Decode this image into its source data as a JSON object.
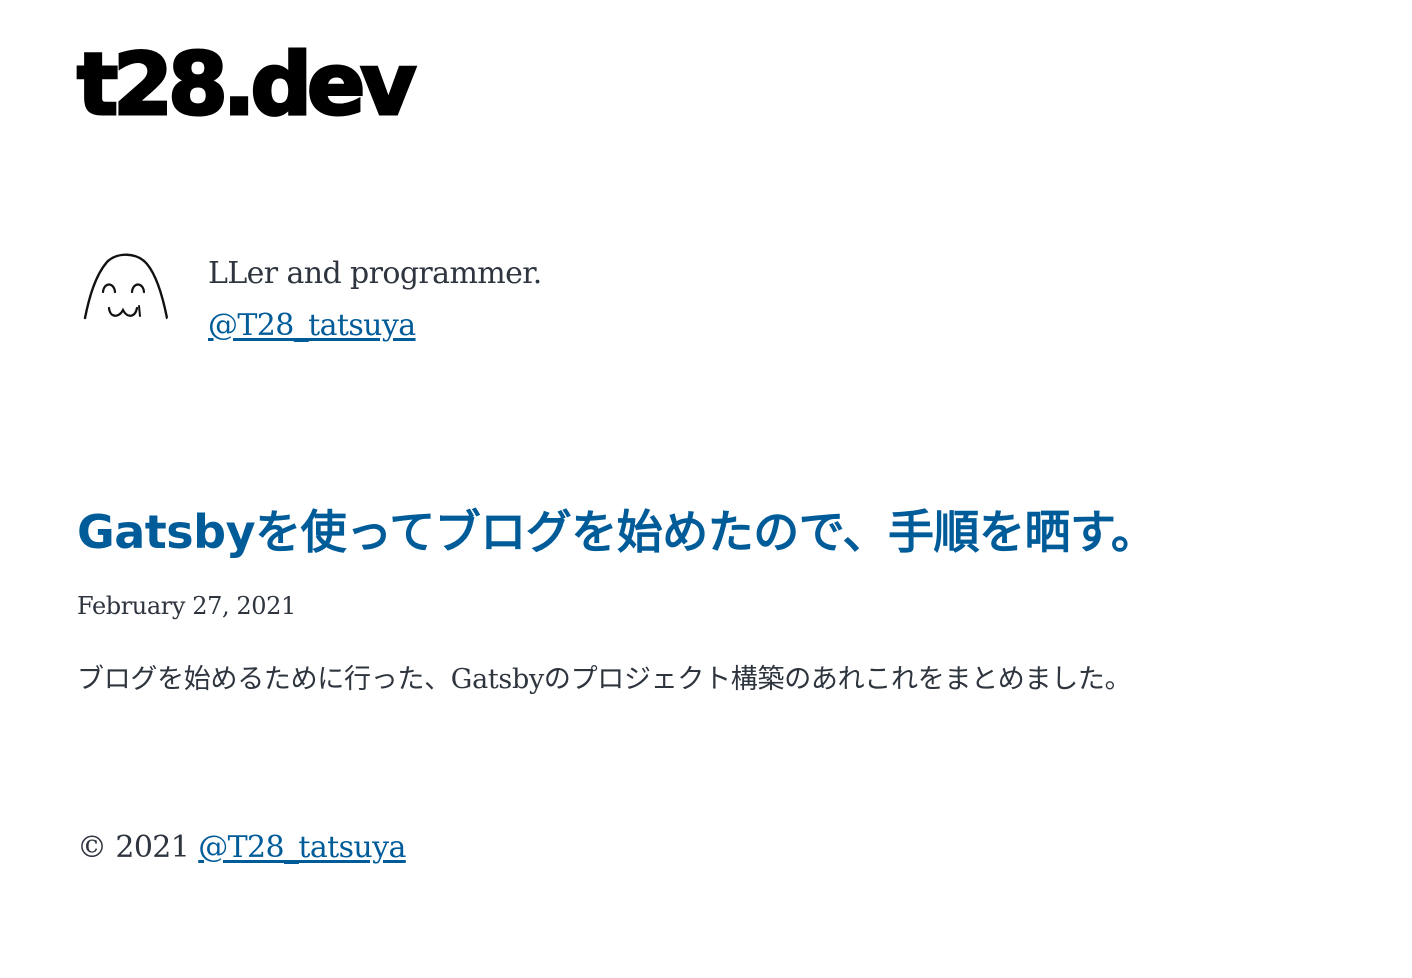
{
  "header": {
    "site_title": "t28.dev"
  },
  "bio": {
    "avatar_icon": "ghost-face-avatar-icon",
    "description": "LLer and programmer.",
    "twitter_handle": "@T28_tatsuya"
  },
  "posts": [
    {
      "title": "Gatsbyを使ってブログを始めたので、手順を晒す。",
      "date": "February 27, 2021",
      "description": "ブログを始めるために行った、Gatsbyのプロジェクト構築のあれこれをまとめました。"
    }
  ],
  "footer": {
    "copyright": "© 2021",
    "author_link": "@T28_tatsuya"
  },
  "colors": {
    "link": "#005b99",
    "text": "#2e353f",
    "title": "#000000",
    "background": "#ffffff"
  }
}
